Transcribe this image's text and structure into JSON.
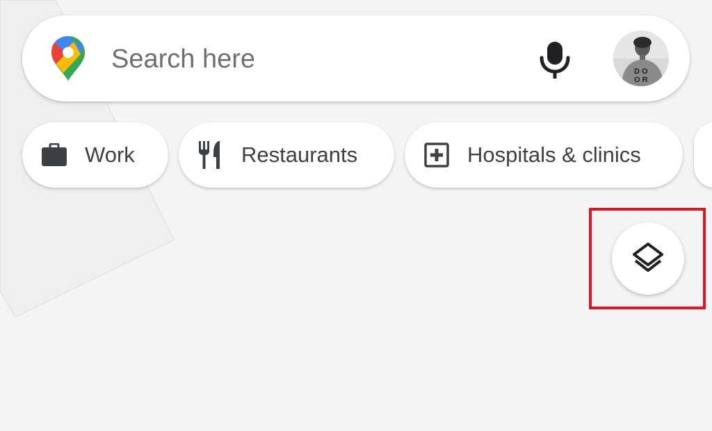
{
  "search": {
    "placeholder": "Search here",
    "value": "",
    "logo_icon": "google-maps-pin-icon",
    "mic_icon": "microphone-icon",
    "avatar_icon": "user-avatar"
  },
  "chips": [
    {
      "label": "Work",
      "icon": "briefcase-icon"
    },
    {
      "label": "Restaurants",
      "icon": "fork-knife-icon"
    },
    {
      "label": "Hospitals & clinics",
      "icon": "hospital-plus-icon"
    }
  ],
  "layers_button": {
    "icon": "layers-icon"
  },
  "colors": {
    "map_background": "#f4f4f5",
    "chip_text": "#3c4043",
    "highlight": "#e0141e",
    "logo_red": "#ea4335",
    "logo_blue": "#4285f4",
    "logo_green": "#34a853",
    "logo_yellow": "#fbbc04"
  }
}
